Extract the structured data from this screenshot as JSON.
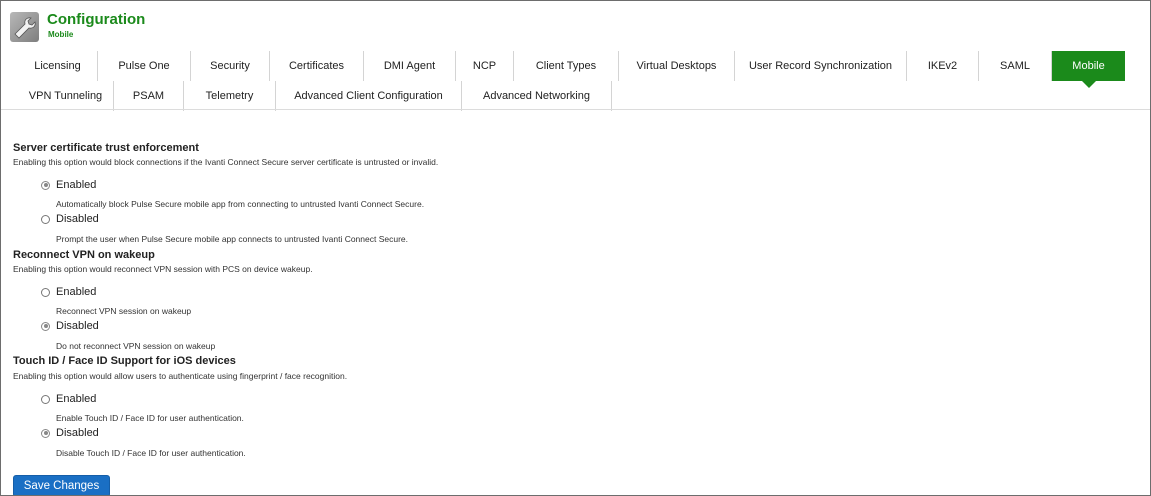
{
  "header": {
    "title": "Configuration",
    "subtitle": "Mobile",
    "icon": "wrench-icon"
  },
  "tabs_row1": [
    {
      "label": "Licensing",
      "active": false
    },
    {
      "label": "Pulse One",
      "active": false
    },
    {
      "label": "Security",
      "active": false
    },
    {
      "label": "Certificates",
      "active": false
    },
    {
      "label": "DMI Agent",
      "active": false
    },
    {
      "label": "NCP",
      "active": false
    },
    {
      "label": "Client Types",
      "active": false
    },
    {
      "label": "Virtual Desktops",
      "active": false
    },
    {
      "label": "User Record Synchronization",
      "active": false
    },
    {
      "label": "IKEv2",
      "active": false
    },
    {
      "label": "SAML",
      "active": false
    },
    {
      "label": "Mobile",
      "active": true
    }
  ],
  "tabs_row2": [
    {
      "label": "VPN Tunneling",
      "active": false
    },
    {
      "label": "PSAM",
      "active": false
    },
    {
      "label": "Telemetry",
      "active": false
    },
    {
      "label": "Advanced Client Configuration",
      "active": false
    },
    {
      "label": "Advanced Networking",
      "active": false
    }
  ],
  "sections": [
    {
      "title": "Server certificate trust enforcement",
      "description": "Enabling this option would block connections if the Ivanti Connect Secure server certificate is untrusted or invalid.",
      "options": [
        {
          "label": "Enabled",
          "checked": true,
          "help": "Automatically block Pulse Secure mobile app from connecting to untrusted Ivanti Connect Secure."
        },
        {
          "label": "Disabled",
          "checked": false,
          "help": "Prompt the user when Pulse Secure mobile app connects to untrusted Ivanti Connect Secure."
        }
      ]
    },
    {
      "title": "Reconnect VPN on wakeup",
      "description": "Enabling this option would reconnect VPN session with PCS on device wakeup.",
      "options": [
        {
          "label": "Enabled",
          "checked": false,
          "help": "Reconnect VPN session on wakeup"
        },
        {
          "label": "Disabled",
          "checked": true,
          "help": "Do not reconnect VPN session on wakeup"
        }
      ]
    },
    {
      "title": "Touch ID / Face ID Support for iOS devices",
      "description": "Enabling this option would allow users to authenticate using fingerprint / face recognition.",
      "options": [
        {
          "label": "Enabled",
          "checked": false,
          "help": "Enable Touch ID / Face ID for user authentication."
        },
        {
          "label": "Disabled",
          "checked": true,
          "help": "Disable Touch ID / Face ID for user authentication."
        }
      ]
    }
  ],
  "save_button": {
    "label": "Save Changes"
  },
  "colors": {
    "accent": "#1b8a1b",
    "button": "#1a6fc4"
  }
}
